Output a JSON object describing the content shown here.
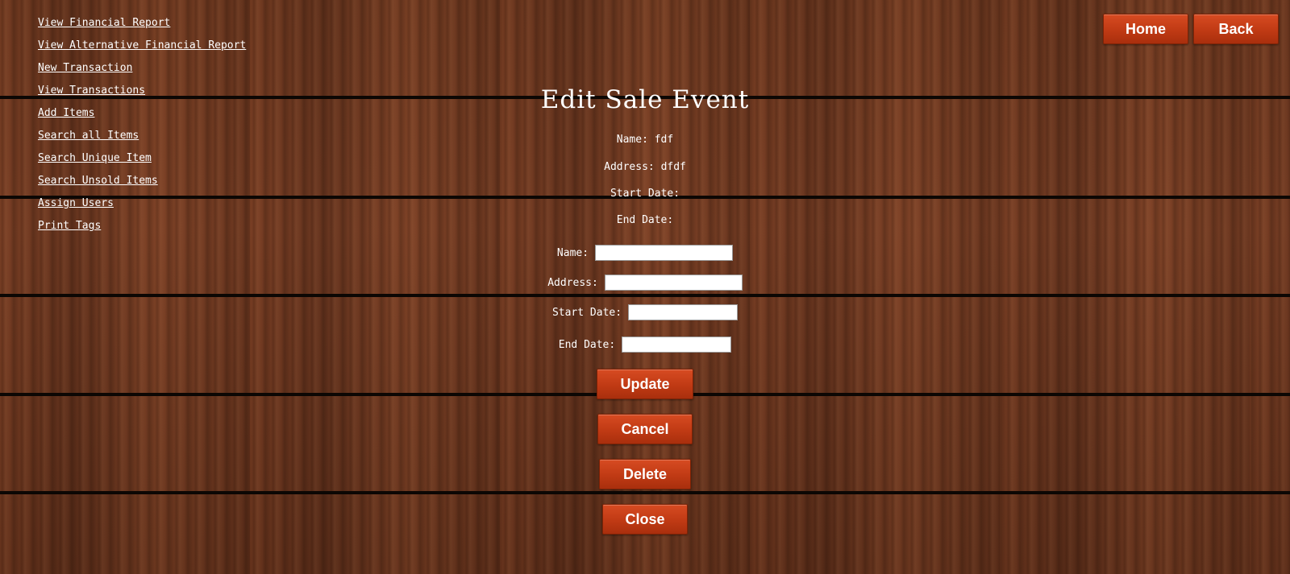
{
  "sidebar": {
    "links": [
      {
        "label": "View Financial Report"
      },
      {
        "label": "View Alternative Financial Report"
      },
      {
        "label": "New Transaction"
      },
      {
        "label": "View Transactions"
      },
      {
        "label": "Add Items"
      },
      {
        "label": "Search all Items"
      },
      {
        "label": "Search Unique Item"
      },
      {
        "label": "Search Unsold Items"
      },
      {
        "label": "Assign Users"
      },
      {
        "label": "Print Tags"
      }
    ]
  },
  "header": {
    "home_label": "Home",
    "back_label": "Back"
  },
  "page": {
    "title": "Edit Sale Event"
  },
  "details": {
    "name": "Name: fdf",
    "address": "Address: dfdf",
    "start_date": "Start Date:",
    "end_date": "End Date:"
  },
  "form": {
    "name_label": "Name:",
    "name_value": "",
    "address_label": "Address:",
    "address_value": "",
    "start_date_label": "Start Date:",
    "start_date_value": "",
    "end_date_label": "End Date:",
    "end_date_value": ""
  },
  "actions": {
    "update_label": "Update",
    "cancel_label": "Cancel",
    "delete_label": "Delete",
    "close_label": "Close"
  },
  "colors": {
    "button": "#c43d16",
    "background_wood": "#6e3a22"
  }
}
